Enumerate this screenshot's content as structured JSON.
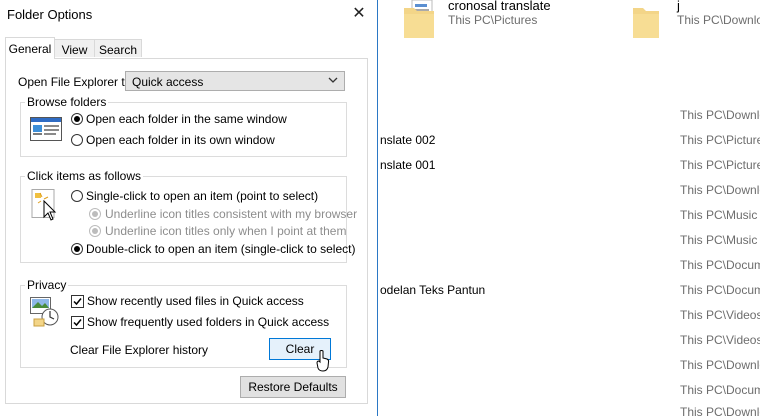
{
  "explorer": {
    "tiles": [
      {
        "name": "cronosal translate",
        "path": "This PC\\Pictures"
      },
      {
        "name": "j",
        "path": "This PC\\Downlo"
      }
    ],
    "rows": [
      {
        "name": "",
        "path": "This PC\\Downlo"
      },
      {
        "name": "nslate 002",
        "path": "This PC\\Picture"
      },
      {
        "name": "nslate 001",
        "path": "This PC\\Picture"
      },
      {
        "name": "",
        "path": "This PC\\Downlo"
      },
      {
        "name": "",
        "path": "This PC\\Music"
      },
      {
        "name": "",
        "path": "This PC\\Music"
      },
      {
        "name": "",
        "path": "This PC\\Docum"
      },
      {
        "name": "",
        "path": "This PC\\Docum"
      },
      {
        "name": "odelan Teks Pantun",
        "path": "This PC\\Docum"
      },
      {
        "name": "",
        "path": "This PC\\Videos"
      },
      {
        "name": "",
        "path": "This PC\\Videos"
      },
      {
        "name": "",
        "path": "This PC\\Downlo"
      },
      {
        "name": "",
        "path": "This PC\\Docum"
      },
      {
        "name": "",
        "path": "This PC\\Downlo"
      },
      {
        "name": "",
        "path": "This PC\\Downlo"
      }
    ]
  },
  "dialog": {
    "title": "Folder Options",
    "tabs": [
      "General",
      "View",
      "Search"
    ],
    "open_label": "Open File Explorer to:",
    "open_value": "Quick access",
    "browse": {
      "label": "Browse folders",
      "opt_same": "Open each folder in the same window",
      "opt_own": "Open each folder in its own window"
    },
    "click": {
      "label": "Click items as follows",
      "opt_single": "Single-click to open an item (point to select)",
      "opt_underline_browser": "Underline icon titles consistent with my browser",
      "opt_underline_point": "Underline icon titles only when I point at them",
      "opt_double": "Double-click to open an item (single-click to select)"
    },
    "privacy": {
      "label": "Privacy",
      "recent_files": "Show recently used files in Quick access",
      "frequent_folders": "Show frequently used folders in Quick access",
      "clear_label": "Clear File Explorer history",
      "clear_button": "Clear"
    },
    "restore_button": "Restore Defaults"
  }
}
